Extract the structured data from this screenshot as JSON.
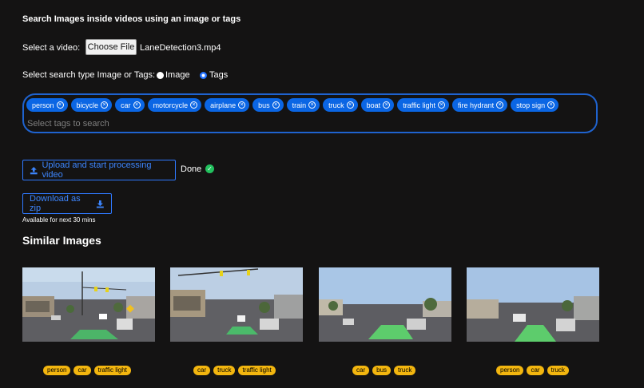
{
  "page": {
    "title": "Search Images inside videos using an image or tags"
  },
  "video": {
    "label": "Select a video:",
    "choose_button": "Choose File",
    "file_name": "LaneDetection3.mp4"
  },
  "search_type": {
    "label": "Select search type Image or Tags:",
    "options": [
      "Image",
      "Tags"
    ],
    "selected": "Tags"
  },
  "tags": {
    "selected": [
      "person",
      "bicycle",
      "car",
      "motorcycle",
      "airplane",
      "bus",
      "train",
      "truck",
      "boat",
      "traffic light",
      "fire hydrant",
      "stop sign"
    ],
    "placeholder": "Select tags to search"
  },
  "upload": {
    "button_label": "Upload and start processing video",
    "status": "Done"
  },
  "download": {
    "button_label": "Download as zip",
    "note": "Available for next 30 mins"
  },
  "results": {
    "heading": "Similar Images",
    "items": [
      {
        "tags": [
          "person",
          "car",
          "traffic light"
        ]
      },
      {
        "tags": [
          "car",
          "truck",
          "traffic light"
        ]
      },
      {
        "tags": [
          "car",
          "bus",
          "truck"
        ]
      },
      {
        "tags": [
          "person",
          "car",
          "truck"
        ]
      }
    ]
  },
  "colors": {
    "background": "#141313",
    "accent": "#0b66e4",
    "tag_chip": "#f3b60f",
    "done": "#22c15e"
  }
}
